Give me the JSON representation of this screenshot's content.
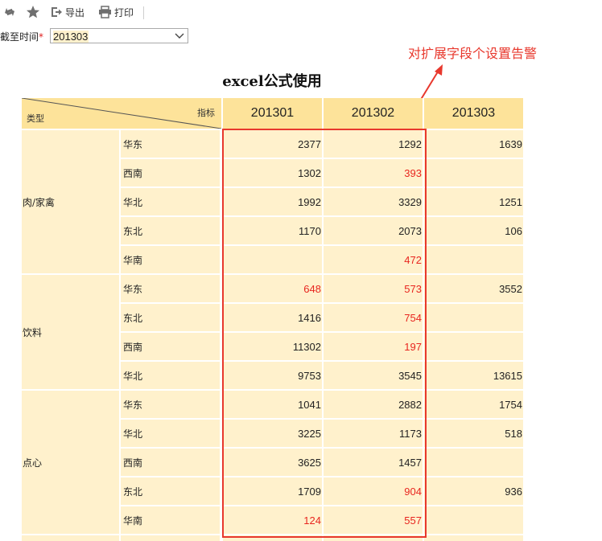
{
  "toolbar": {
    "export_label": "导出",
    "print_label": "打印"
  },
  "filter": {
    "label": "截至时间",
    "required_mark": "*",
    "value": "201303"
  },
  "annotation": {
    "text": "对扩展字段个设置告警",
    "color": "#e8382d"
  },
  "report": {
    "title": "excel公式使用",
    "corner_top": "指标",
    "corner_bottom": "类型",
    "columns": [
      "201301",
      "201302",
      "201303"
    ],
    "groups": [
      {
        "category": "肉/家禽",
        "rows": [
          {
            "region": "华东",
            "values": [
              "2377",
              "1292",
              "1639"
            ],
            "alert": [
              false,
              false,
              false
            ]
          },
          {
            "region": "西南",
            "values": [
              "1302",
              "393",
              ""
            ],
            "alert": [
              false,
              true,
              false
            ]
          },
          {
            "region": "华北",
            "values": [
              "1992",
              "3329",
              "1251"
            ],
            "alert": [
              false,
              false,
              false
            ]
          },
          {
            "region": "东北",
            "values": [
              "1170",
              "2073",
              "106"
            ],
            "alert": [
              false,
              false,
              false
            ]
          },
          {
            "region": "华南",
            "values": [
              "",
              "472",
              ""
            ],
            "alert": [
              false,
              true,
              false
            ]
          }
        ]
      },
      {
        "category": "饮料",
        "rows": [
          {
            "region": "华东",
            "values": [
              "648",
              "573",
              "3552"
            ],
            "alert": [
              true,
              true,
              false
            ]
          },
          {
            "region": "东北",
            "values": [
              "1416",
              "754",
              ""
            ],
            "alert": [
              false,
              true,
              false
            ]
          },
          {
            "region": "西南",
            "values": [
              "11302",
              "197",
              ""
            ],
            "alert": [
              false,
              true,
              false
            ]
          },
          {
            "region": "华北",
            "values": [
              "9753",
              "3545",
              "13615"
            ],
            "alert": [
              false,
              false,
              false
            ]
          }
        ]
      },
      {
        "category": "点心",
        "rows": [
          {
            "region": "华东",
            "values": [
              "1041",
              "2882",
              "1754"
            ],
            "alert": [
              false,
              false,
              false
            ]
          },
          {
            "region": "华北",
            "values": [
              "3225",
              "1173",
              "518"
            ],
            "alert": [
              false,
              false,
              false
            ]
          },
          {
            "region": "西南",
            "values": [
              "3625",
              "1457",
              ""
            ],
            "alert": [
              false,
              false,
              false
            ]
          },
          {
            "region": "东北",
            "values": [
              "1709",
              "904",
              "936"
            ],
            "alert": [
              false,
              true,
              false
            ]
          },
          {
            "region": "华南",
            "values": [
              "124",
              "557",
              ""
            ],
            "alert": [
              true,
              true,
              false
            ]
          }
        ]
      }
    ]
  },
  "colors": {
    "header_bg": "#fde39a",
    "cell_bg": "#fff1cc",
    "alert_text": "#e8251f"
  }
}
